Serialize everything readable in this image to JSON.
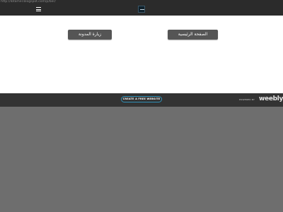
{
  "browser": {
    "url": "http://ibtamer.blogspot.com/p/ber/"
  },
  "header": {
    "menu_icon": "hamburger-menu-icon",
    "logo_icon": "site-logo-icon"
  },
  "main": {
    "buttons": [
      {
        "label": "زيارة المدونة"
      },
      {
        "label": "الصفحة الرئيسية"
      }
    ]
  },
  "footer": {
    "cta_label": "CREATE A FREE WEBSITE",
    "powered_label": "POWERED BY",
    "brand": "weebly",
    "accent_color": "#2f8fb5"
  }
}
